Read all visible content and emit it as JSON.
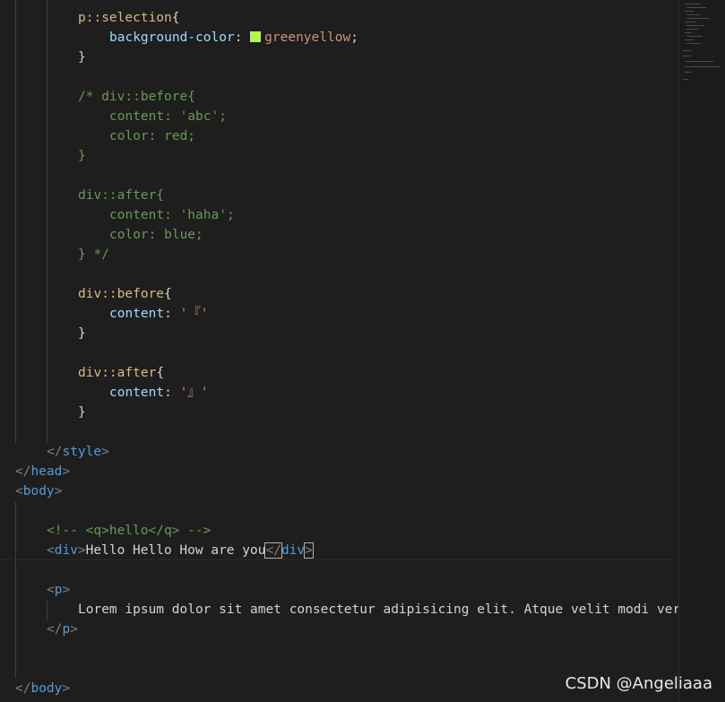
{
  "editor": {
    "lines": {
      "l1": {
        "sel": "p::selection",
        "open": "{"
      },
      "l2": {
        "prop": "background-color",
        "colon": ": ",
        "val": "greenyellow",
        "semi": ";"
      },
      "l3": {
        "close": "}"
      },
      "l5": {
        "text": "/* div::before{"
      },
      "l6": {
        "text": "content: 'abc';"
      },
      "l7": {
        "text": "color: red;"
      },
      "l8": {
        "text": "}"
      },
      "l10": {
        "text": "div::after{"
      },
      "l11": {
        "text": "content: 'haha';"
      },
      "l12": {
        "text": "color: blue;"
      },
      "l13": {
        "text": "} */"
      },
      "l15": {
        "sel": "div::before",
        "open": "{"
      },
      "l16": {
        "prop": "content",
        "colon": ": ",
        "val": "'『'"
      },
      "l17": {
        "close": "}"
      },
      "l19": {
        "sel": "div::after",
        "open": "{"
      },
      "l20": {
        "prop": "content",
        "colon": ": ",
        "val": "'』'"
      },
      "l21": {
        "close": "}"
      },
      "l23": {
        "lt": "</",
        "tag": "style",
        "gt": ">"
      },
      "l24": {
        "lt": "</",
        "tag": "head",
        "gt": ">"
      },
      "l25": {
        "lt": "<",
        "tag": "body",
        "gt": ">"
      },
      "l27": {
        "text": "<!-- <q>hello</q> -->"
      },
      "l28": {
        "lt": "<",
        "tag": "div",
        "gt": ">",
        "content": "Hello Hello How are you",
        "clt": "</",
        "ctag": "div",
        "cgt": ">"
      },
      "l30": {
        "lt": "<",
        "tag": "p",
        "gt": ">"
      },
      "l31": {
        "text": "Lorem ipsum dolor sit amet consectetur adipisicing elit. Atque velit modi veritatis"
      },
      "l32": {
        "lt": "</",
        "tag": "p",
        "gt": ">"
      },
      "l35": {
        "lt": "</",
        "tag": "body",
        "gt": ">"
      }
    },
    "colors": {
      "background": "#1e1e1e",
      "tag": "#569cd6",
      "selector": "#d7ba7d",
      "property": "#9cdcfe",
      "string": "#ce9178",
      "comment": "#6a9955",
      "swatch": "#adff2f"
    }
  },
  "watermark": "CSDN @Angeliaaa"
}
